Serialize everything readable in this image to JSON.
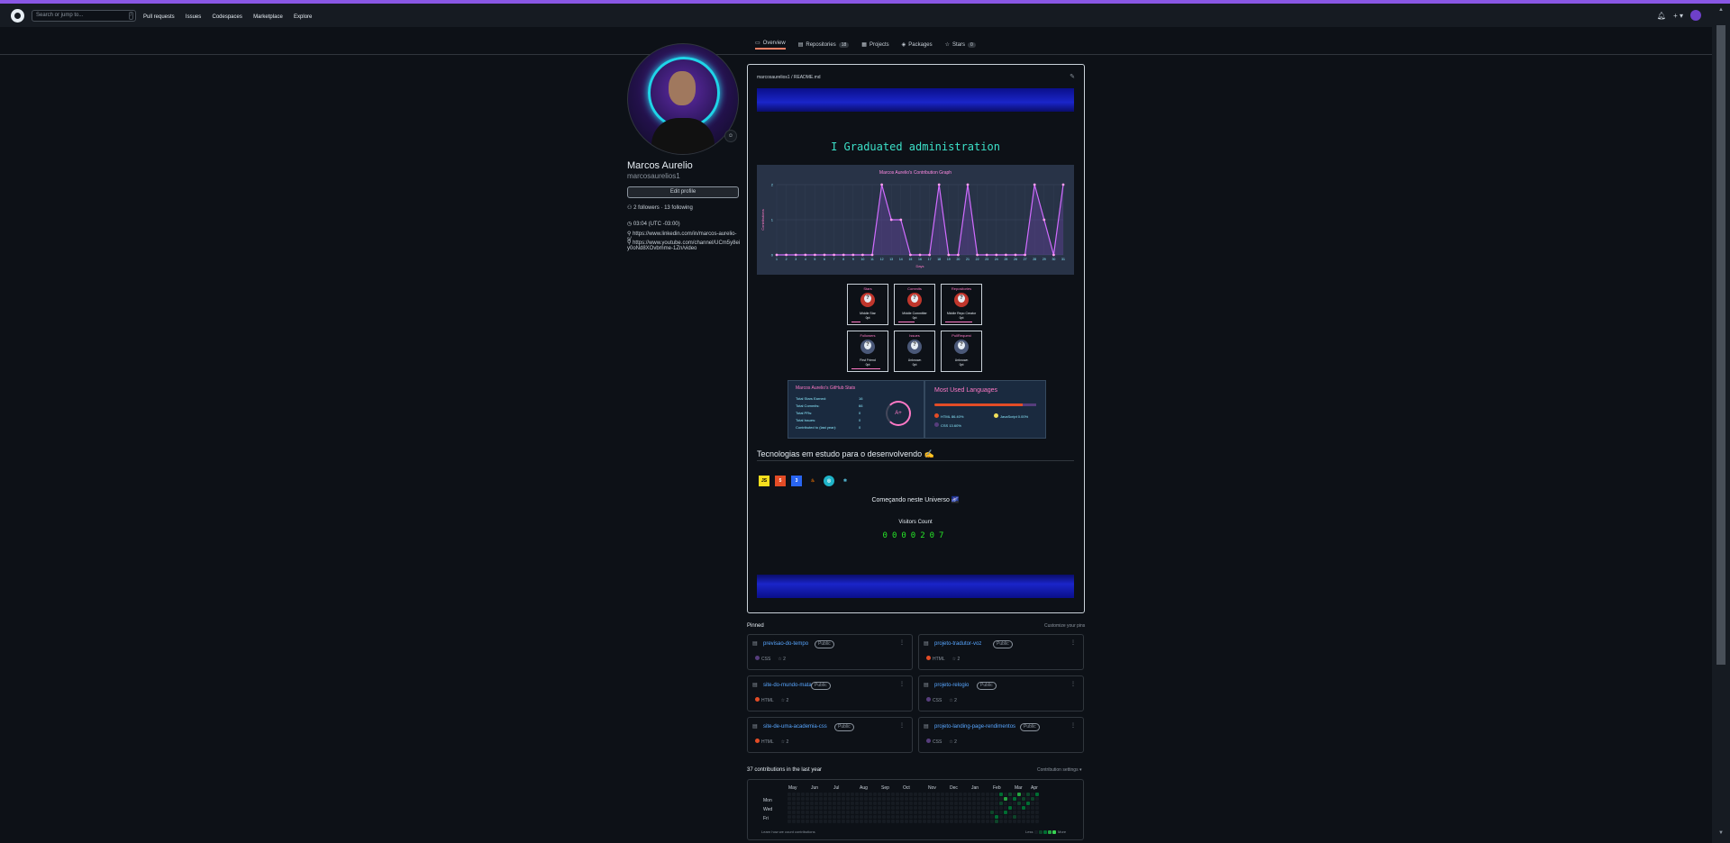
{
  "header": {
    "search_placeholder": "Search or jump to...",
    "search_hint": "/",
    "nav": [
      "Pull requests",
      "Issues",
      "Codespaces",
      "Marketplace",
      "Explore"
    ],
    "plus_label": "+ ▾"
  },
  "tabs": [
    {
      "label": "Overview",
      "icon": "book-icon",
      "count": ""
    },
    {
      "label": "Repositories",
      "icon": "repo-icon",
      "count": "18"
    },
    {
      "label": "Projects",
      "icon": "table-icon",
      "count": ""
    },
    {
      "label": "Packages",
      "icon": "package-icon",
      "count": ""
    },
    {
      "label": "Stars",
      "icon": "star-icon",
      "count": "0"
    }
  ],
  "profile": {
    "name": "Marcos Aurelio",
    "login": "marcosaurelios1",
    "edit_label": "Edit profile",
    "followers": "2 followers",
    "following": "13 following",
    "dot": "·",
    "time": "03:04 (UTC -03:00)",
    "link1": "https://www.linkedin.com/in/marcos-aurelio-s/",
    "link2": "https://www.youtube.com/channel/UCm5y8eiy0oNd8XOvbmme-1Zn/video"
  },
  "readme": {
    "title": "marcosaurelios1 / README.md",
    "typing_text": "I Graduated administration",
    "graph_title": "Marcos Aurelio's Contribution Graph",
    "graph_ylabel": "Contributions",
    "graph_xlabel": "Days",
    "tech_title": "Tecnologias em estudo para o desenvolvendo ✍️",
    "tech_icons": [
      "JS",
      "5",
      "3",
      "♨",
      "◎",
      "⚛"
    ],
    "universe_text": "Começando neste Universo 🌌",
    "visitor_title": "Visitors Count",
    "visitor_count": "0000207"
  },
  "trophies": [
    {
      "label": "Stars",
      "rank": "?",
      "title": "Middle Star",
      "points": "0pt"
    },
    {
      "label": "Commits",
      "rank": "?",
      "title": "Middle Committer",
      "points": "0pt"
    },
    {
      "label": "Repositories",
      "rank": "?",
      "title": "Middle Repo Creator",
      "points": "0pt"
    },
    {
      "label": "Followers",
      "rank": "?",
      "title": "First Friend",
      "points": "0pt"
    },
    {
      "label": "Issues",
      "rank": "?",
      "title": "Unknown",
      "points": "0pt"
    },
    {
      "label": "PullRequest",
      "rank": "?",
      "title": "Unknown",
      "points": "0pt"
    }
  ],
  "stats": {
    "title": "Marcos Aurelio's GitHub Stats",
    "rows": [
      {
        "label": "Total Stars Earned:",
        "value": "16"
      },
      {
        "label": "Total Commits:",
        "value": "66"
      },
      {
        "label": "Total PRs:",
        "value": "0"
      },
      {
        "label": "Total Issues:",
        "value": "0"
      },
      {
        "label": "Contributed to (last year):",
        "value": "0"
      }
    ],
    "grade": "A+"
  },
  "languages": {
    "title": "Most Used Languages",
    "items": [
      {
        "name": "HTML 86.40%",
        "color": "#e34c26"
      },
      {
        "name": "JavaScript 0.00%",
        "color": "#f1e05a"
      },
      {
        "name": "CSS 13.60%",
        "color": "#563d7c"
      }
    ]
  },
  "pinned": {
    "title": "Pinned",
    "customize": "Customize your pins",
    "public_label": "Public",
    "repos": [
      {
        "name": "previsao-do-tempo",
        "lang": "CSS",
        "lang_color": "#563d7c",
        "stars": "2"
      },
      {
        "name": "projeto-tradutor-voz",
        "lang": "HTML",
        "lang_color": "#e34c26",
        "stars": "2"
      },
      {
        "name": "site-do-mundo-mata",
        "lang": "HTML",
        "lang_color": "#e34c26",
        "stars": "2"
      },
      {
        "name": "projeto-relogio",
        "lang": "CSS",
        "lang_color": "#563d7c",
        "stars": "2"
      },
      {
        "name": "site-de-uma-academia-css",
        "lang": "HTML",
        "lang_color": "#e34c26",
        "stars": "2"
      },
      {
        "name": "projeto-landing-page-rendimentos",
        "lang": "CSS",
        "lang_color": "#563d7c",
        "stars": "2"
      }
    ]
  },
  "contributions": {
    "title": "37 contributions in the last year",
    "settings": "Contribution settings ▾",
    "months": [
      "May",
      "Jun",
      "Jul",
      "Aug",
      "Sep",
      "Oct",
      "Nov",
      "Dec",
      "Jan",
      "Feb",
      "Mar",
      "Apr"
    ],
    "days": [
      "Mon",
      "Wed",
      "Fri"
    ],
    "learn": "Learn how we count contributions",
    "less": "Less",
    "more": "More"
  },
  "chart_data": {
    "type": "line",
    "title": "Marcos Aurelio's Contribution Graph",
    "xlabel": "Days",
    "ylabel": "Contributions",
    "x": [
      1,
      2,
      3,
      4,
      5,
      6,
      7,
      8,
      9,
      10,
      11,
      12,
      13,
      14,
      15,
      16,
      17,
      18,
      19,
      20,
      21,
      22,
      23,
      24,
      25,
      26,
      27,
      28,
      29,
      30,
      31
    ],
    "values": [
      0,
      0,
      0,
      0,
      0,
      0,
      0,
      0,
      0,
      0,
      0,
      2,
      1,
      1,
      0,
      0,
      0,
      2,
      0,
      0,
      2,
      0,
      0,
      0,
      0,
      0,
      0,
      2,
      1,
      0,
      2
    ],
    "ylim": [
      0,
      2
    ],
    "color": "#d16cff"
  }
}
